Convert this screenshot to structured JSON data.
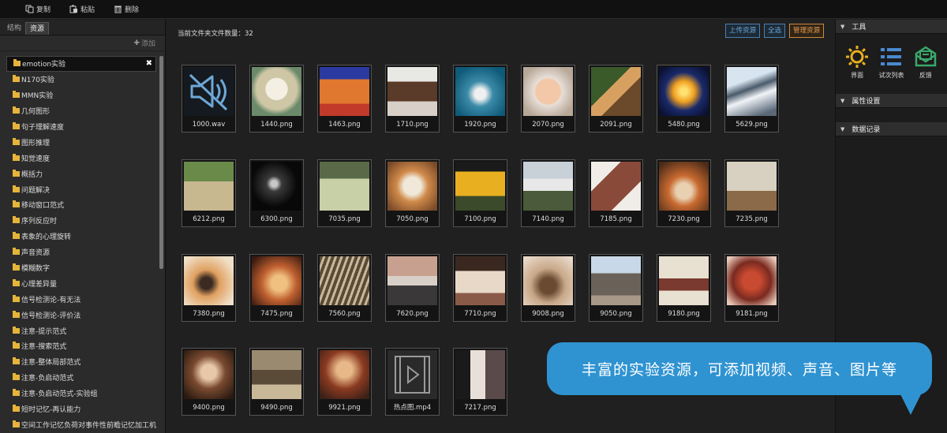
{
  "toolbar": {
    "copy": "复制",
    "paste": "粘贴",
    "delete": "删除"
  },
  "left": {
    "tabs": [
      "结构",
      "资源"
    ],
    "add_label": "添加",
    "items": [
      "emotion实验",
      "N170实验",
      "MMN实验",
      "几何图形",
      "句子理解速度",
      "图形推理",
      "知觉速度",
      "概括力",
      "问题解决",
      "移动窗口范式",
      "序列反应时",
      "表象的心理旋转",
      "声音资源",
      "模糊数字",
      "心理差异量",
      "信号检测论-有无法",
      "信号检测论-评价法",
      "注意-提示范式",
      "注意-搜索范式",
      "注意-整体局部范式",
      "注意-负启动范式",
      "注意-负启动范式-实验组",
      "短时记忆-再认能力",
      "空间工作记忆负荷对事件性前瞻记忆加工机制的"
    ]
  },
  "center": {
    "count_text": "当前文件夹文件数量：32",
    "buttons": {
      "upload": "上传资源",
      "select_all": "全选",
      "manage": "管理资源"
    },
    "files": [
      "1000.wav",
      "1440.png",
      "1463.png",
      "1710.png",
      "1920.png",
      "2070.png",
      "2091.png",
      "5480.png",
      "5629.png",
      "6212.png",
      "6300.png",
      "7035.png",
      "7050.png",
      "7100.png",
      "7140.png",
      "7185.png",
      "7230.png",
      "7235.png",
      "7380.png",
      "7475.png",
      "7560.png",
      "7620.png",
      "7710.png",
      "9008.png",
      "9050.png",
      "9180.png",
      "9181.png",
      "9400.png",
      "9490.png",
      "9921.png",
      "热点图.mp4",
      "7217.png"
    ]
  },
  "right": {
    "tools_header": "工具",
    "tools": [
      "界面",
      "试次列表",
      "反馈"
    ],
    "props_header": "属性设置",
    "records_header": "数据记录"
  },
  "callout": "丰富的实验资源，可添加视频、声音、图片等"
}
